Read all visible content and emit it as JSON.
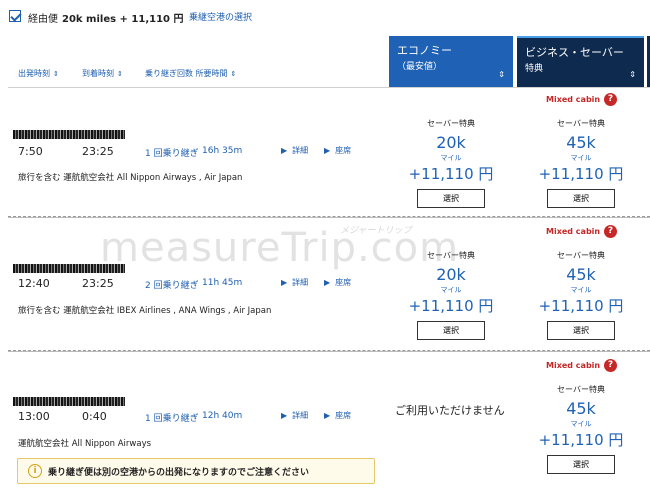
{
  "top": {
    "via_label": "経由便",
    "via_miles": "20k miles + 11,110 円",
    "airport_select_link": "乗継空港の選択"
  },
  "sort_headers": {
    "depart": "出発時刻",
    "arrive": "到着時刻",
    "transfers": "乗り継ぎ回数 所要時間"
  },
  "columns": {
    "economy": {
      "title": "エコノミー",
      "sub": "（最安値）"
    },
    "business": {
      "title": "ビジネス・セーバー",
      "sub": "特典"
    }
  },
  "flights": [
    {
      "depart": "7:50",
      "arrive": "23:25",
      "stops": "1 回乗り継ぎ",
      "duration": "16h 35m",
      "details": "詳細",
      "seats": "座席",
      "airlines": "旅行を含む 運航航空会社 All Nippon Airways , Air Japan",
      "mixed_cabin": "Mixed cabin",
      "economy": {
        "label": "セーバー特典",
        "miles": "20k",
        "unit": "マイル",
        "price": "+11,110 円",
        "select": "選択"
      },
      "business": {
        "label": "セーバー特典",
        "miles": "45k",
        "unit": "マイル",
        "price": "+11,110 円",
        "select": "選択"
      }
    },
    {
      "depart": "12:40",
      "arrive": "23:25",
      "stops": "2 回乗り継ぎ",
      "duration": "11h 45m",
      "details": "詳細",
      "seats": "座席",
      "airlines": "旅行を含む 運航航空会社 IBEX Airlines , ANA Wings , Air Japan",
      "mixed_cabin": "Mixed cabin",
      "economy": {
        "label": "セーバー特典",
        "miles": "20k",
        "unit": "マイル",
        "price": "+11,110 円",
        "select": "選択"
      },
      "business": {
        "label": "セーバー特典",
        "miles": "45k",
        "unit": "マイル",
        "price": "+11,110 円",
        "select": "選択"
      }
    },
    {
      "depart": "13:00",
      "arrive": "0:40",
      "stops": "1 回乗り継ぎ",
      "duration": "12h 40m",
      "details": "詳細",
      "seats": "座席",
      "airlines": "運航航空会社 All Nippon Airways",
      "mixed_cabin": "Mixed cabin",
      "economy_unavailable": "ご利用いただけません",
      "business": {
        "label": "セーバー特典",
        "miles": "45k",
        "unit": "マイル",
        "price": "+11,110 円",
        "select": "選択"
      },
      "notice": "乗り継ぎ便は別の空港からの出発になりますのでご注意ください"
    }
  ],
  "watermark": {
    "main": "measureTrip.com",
    "sub": "メジャートリップ"
  },
  "colors": {
    "brand_blue": "#1f62b5",
    "navy": "#0f2a4f",
    "alert_red": "#c62828",
    "warning_yellow": "#e6c86a"
  },
  "icons": {
    "checkbox": "checkbox-checked-icon",
    "sort": "sort-arrows-icon",
    "help": "question-circle-icon",
    "info": "info-circle-icon",
    "expand": "triangle-right-icon"
  }
}
